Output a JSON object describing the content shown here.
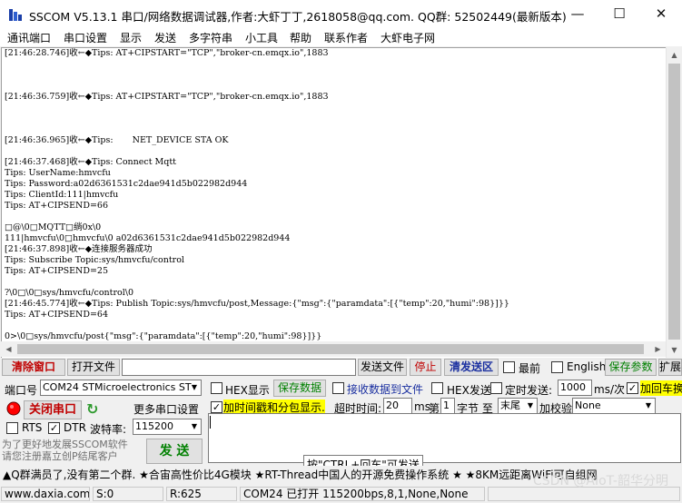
{
  "window": {
    "title": "SSCOM V5.13.1 串口/网络数据调试器,作者:大虾丁丁,2618058@qq.com. QQ群: 52502449(最新版本)",
    "minimize": "—",
    "maximize": "☐",
    "close": "✕"
  },
  "menu": [
    "通讯端口",
    "串口设置",
    "显示",
    "发送",
    "多字符串",
    "小工具",
    "帮助",
    "联系作者",
    "大虾电子网"
  ],
  "receive": {
    "lines": [
      "[21:46:28.746]收←◆Tips: AT+CIPSTART=\"TCP\",\"broker-cn.emqx.io\",1883",
      "",
      "",
      "",
      "[21:46:36.759]收←◆Tips: AT+CIPSTART=\"TCP\",\"broker-cn.emqx.io\",1883",
      "",
      "",
      "",
      "[21:46:36.965]收←◆Tips:       NET_DEVICE STA OK",
      "",
      "[21:46:37.468]收←◆Tips: Connect Mqtt",
      "Tips: UserName:hmvcfu",
      "Tips: Password:a02d6361531c2dae941d5b022982d944",
      "Tips: ClientId:111|hmvcfu",
      "Tips: AT+CIPSEND=66",
      "",
      "□@\\0□MQTT□绱0x\\0",
      "111|hmvcfu\\0□hmvcfu\\0 a02d6361531c2dae941d5b022982d944",
      "[21:46:37.898]收←◆连接服务器成功",
      "Tips: Subscribe Topic:sys/hmvcfu/control",
      "Tips: AT+CIPSEND=25",
      "",
      "?\\0□\\0□sys/hmvcfu/control\\0",
      "[21:46:45.774]收←◆Tips: Publish Topic:sys/hmvcfu/post,Message:{\"msg\":{\"paramdata\":[{\"temp\":20,\"humi\":98}]}}",
      "Tips: AT+CIPSEND=64",
      "",
      "0>\\0□sys/hmvcfu/post{\"msg\":{\"paramdata\":[{\"temp\":20,\"humi\":98}]}}"
    ]
  },
  "toolbar": {
    "clear": "清除窗口",
    "open_file": "打开文件",
    "send_file": "发送文件",
    "stop": "停止",
    "clear_send": "清发送区",
    "latest": "最前",
    "english": "English",
    "save_params": "保存参数",
    "expand": "扩展"
  },
  "port": {
    "label": "端口号",
    "value": "COM24 STMicroelectronics ST",
    "open_close": "关闭串口",
    "more_settings": "更多串口设置",
    "rts": "RTS",
    "dtr": "DTR",
    "baud_label": "波特率:",
    "baud": "115200"
  },
  "options": {
    "hex_display": "HEX显示",
    "save_data": "保存数据",
    "recv_to_file": "接收数据到文件",
    "hex_send": "HEX发送",
    "timed_send": "定时发送:",
    "interval": "1000",
    "interval_unit": "ms/次",
    "add_crlf": "加回车换行",
    "timestamp": "加时间戳和分包显示.",
    "timeout_label": "超时时间:",
    "timeout": "20",
    "ms": "ms",
    "nth": "第",
    "byte_index": "1",
    "byte_to": "字节 至",
    "tail": "末尾",
    "checksum": "加校验",
    "checksum_value": "None"
  },
  "promo": {
    "line1": "为了更好地发展SSCOM软件",
    "line2": "请您注册嘉立创P结尾客户",
    "send": "发 送"
  },
  "send_hint": "按\"CTRL+回车\"可发送",
  "ticker": "▲Q群满员了,没有第二个群. ★合宙高性价比4G模块 ★RT-Thread中国人的开源免费操作系统 ★ ★8KM远距离WiFi可自组网",
  "status": {
    "site": "www.daxia.com",
    "sent": "S:0",
    "received": "R:625",
    "port_info": "COM24 已打开  115200bps,8,1,None,None"
  },
  "watermark": "CSDN @AIoT-韶华分明"
}
